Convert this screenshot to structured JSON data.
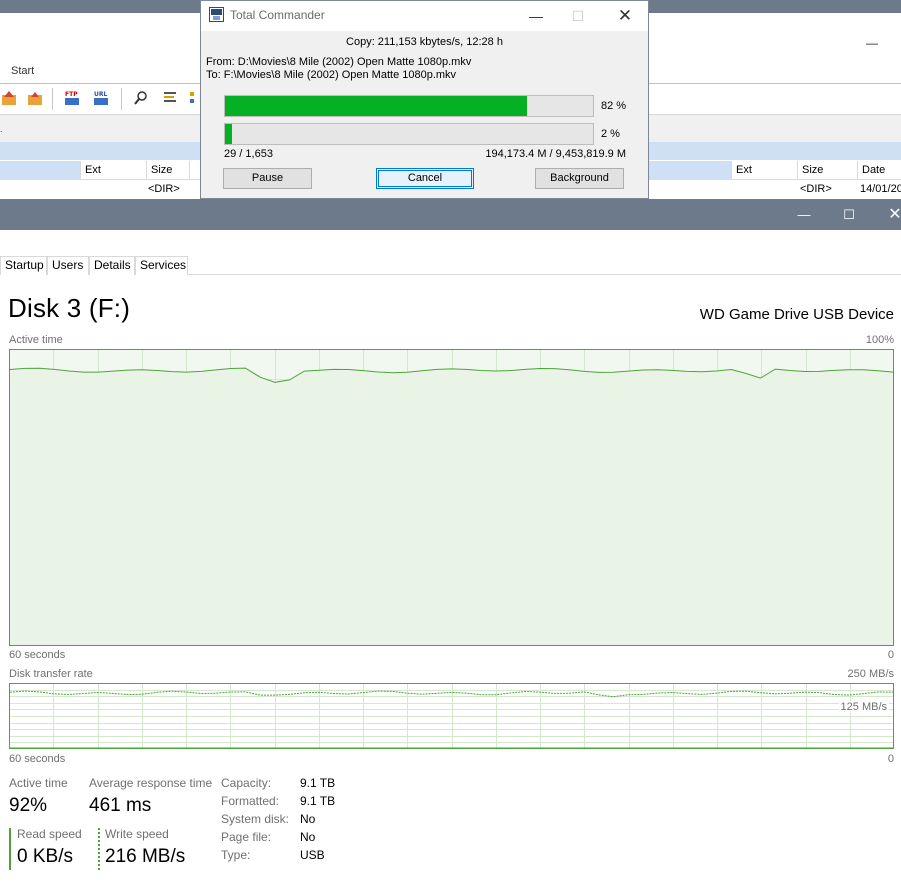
{
  "total_commander": {
    "menu_start": "Start",
    "left_columns": {
      "ext": "Ext",
      "size": "Size"
    },
    "left_row": {
      "size": "<DIR>"
    },
    "right_columns": {
      "ext": "Ext",
      "size": "Size",
      "date": "Date"
    },
    "right_row": {
      "size": "<DIR>",
      "date": "14/01/20"
    },
    "toolbar_icons": [
      "folder-up-icon",
      "folder-icon",
      "ftp-icon",
      "url-icon",
      "search-icon",
      "list-icon",
      "tree-icon"
    ]
  },
  "copy_dialog": {
    "title": "Total Commander",
    "copy_status": "Copy: 211,153 kbytes/s, 12:28 h",
    "from": "From: D:\\Movies\\8 Mile (2002) Open Matte 1080p.mkv",
    "to": "To:  F:\\Movies\\8 Mile (2002) Open Matte 1080p.mkv",
    "progress_file_pct": 82,
    "progress_file_label": "82 %",
    "progress_total_pct": 2,
    "progress_total_label": "2 %",
    "files_count": "29 / 1,653",
    "bytes_count": "194,173.4 M / 9,453,819.9 M",
    "buttons": {
      "pause": "Pause",
      "cancel": "Cancel",
      "background": "Background"
    },
    "accent_color": "#06b025"
  },
  "task_manager": {
    "tabs": [
      "Startup",
      "Users",
      "Details",
      "Services"
    ],
    "disk_title": "Disk 3 (F:)",
    "disk_model": "WD Game Drive USB Device",
    "active_time_chart": {
      "caption": "Active time",
      "max_label": "100%",
      "left_axis": "60 seconds",
      "right_axis": "0"
    },
    "transfer_chart": {
      "caption": "Disk transfer rate",
      "max_label": "250 MB/s",
      "mid_label": "125 MB/s",
      "left_axis": "60 seconds",
      "right_axis": "0"
    },
    "stats": {
      "active_time_label": "Active time",
      "active_time_value": "92%",
      "avg_response_label": "Average response time",
      "avg_response_value": "461 ms",
      "read_speed_label": "Read speed",
      "read_speed_value": "0 KB/s",
      "write_speed_label": "Write speed",
      "write_speed_value": "216 MB/s"
    },
    "properties": [
      {
        "label": "Capacity:",
        "value": "9.1 TB"
      },
      {
        "label": "Formatted:",
        "value": "9.1 TB"
      },
      {
        "label": "System disk:",
        "value": "No"
      },
      {
        "label": "Page file:",
        "value": "No"
      },
      {
        "label": "Type:",
        "value": "USB"
      }
    ],
    "chart_color": "#4da33c",
    "chart_fill": "#f1f8ef"
  }
}
